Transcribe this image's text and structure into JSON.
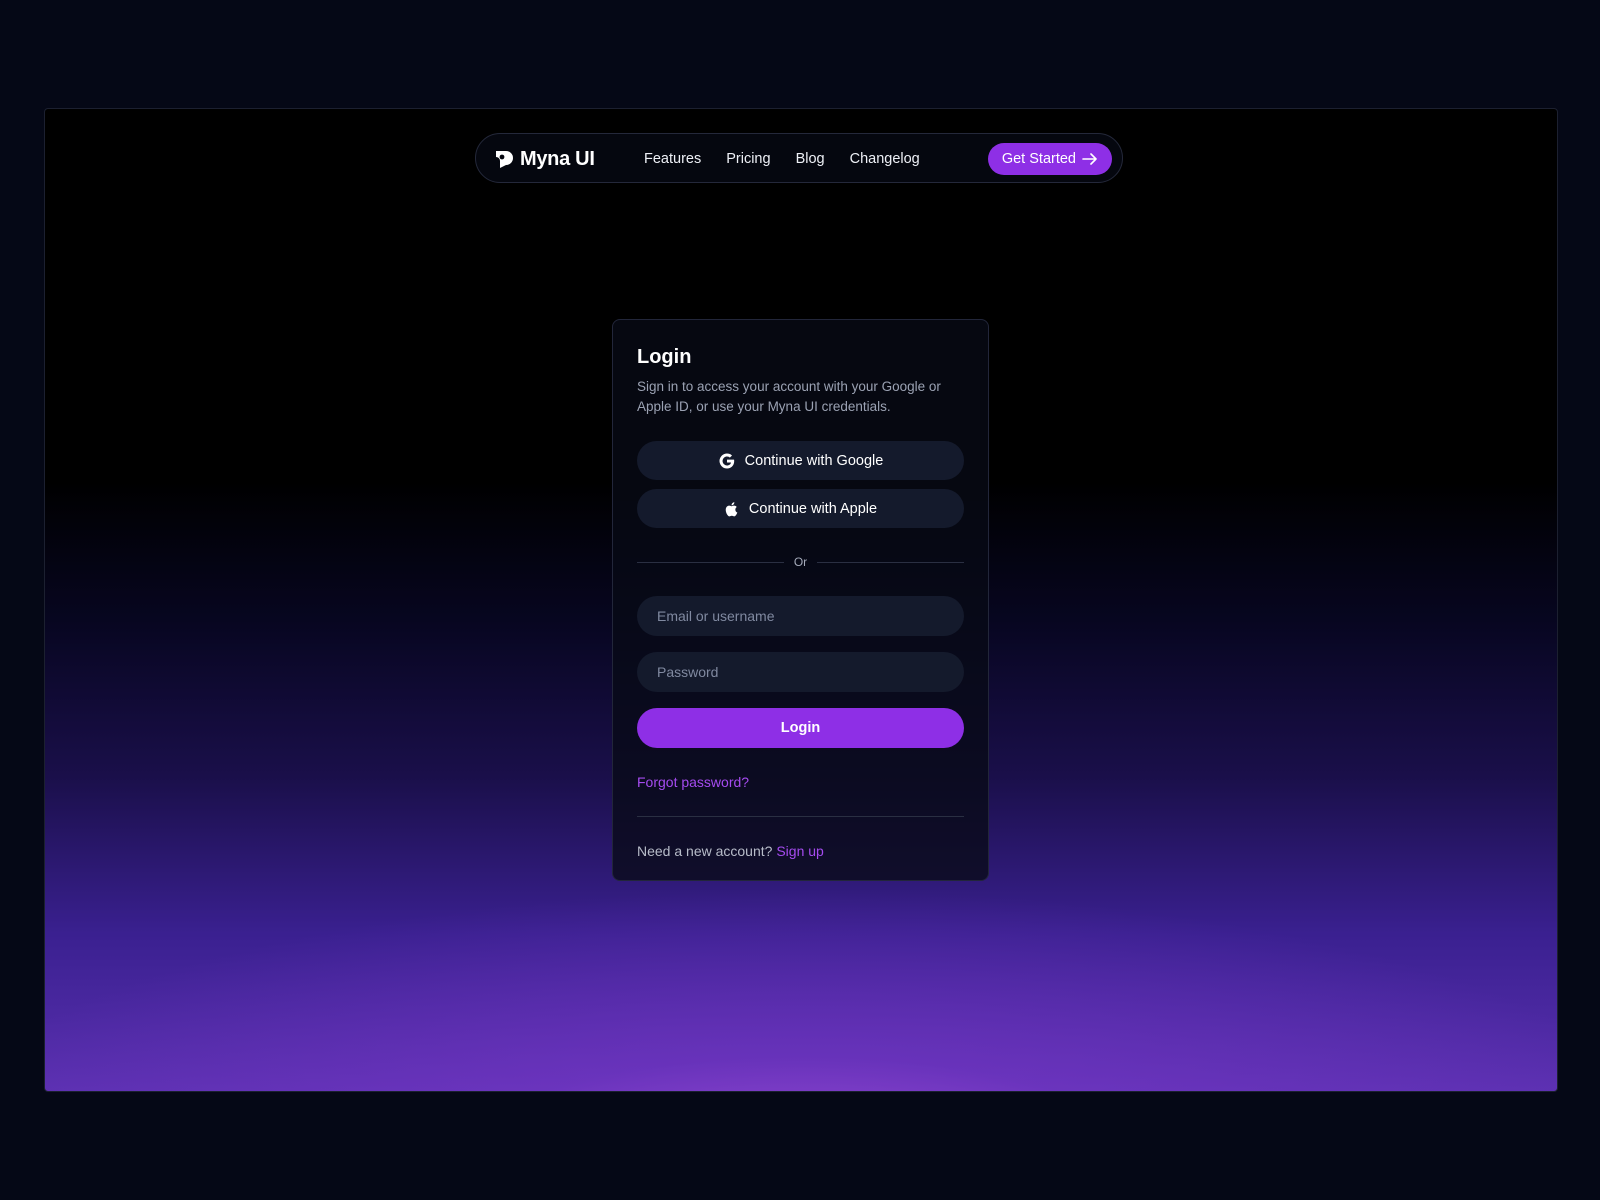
{
  "nav": {
    "brand": "Myna UI",
    "links": [
      "Features",
      "Pricing",
      "Blog",
      "Changelog"
    ],
    "cta_label": "Get Started"
  },
  "login": {
    "title": "Login",
    "description": "Sign in to access your account with your Google or Apple ID, or use your Myna UI credentials.",
    "google_label": "Continue with Google",
    "apple_label": "Continue with Apple",
    "divider_label": "Or",
    "email_placeholder": "Email or username",
    "password_placeholder": "Password",
    "submit_label": "Login",
    "forgot_label": "Forgot password?",
    "signup_prompt": "Need a new account?",
    "signup_label": "Sign up"
  },
  "icons": {
    "brand": "myna-logo-icon",
    "cta": "arrow-right-icon",
    "google": "google-icon",
    "apple": "apple-icon"
  },
  "colors": {
    "accent": "#8e2fe6",
    "link": "#a54bf0",
    "background": "#050816",
    "surface": "#141a2c"
  }
}
